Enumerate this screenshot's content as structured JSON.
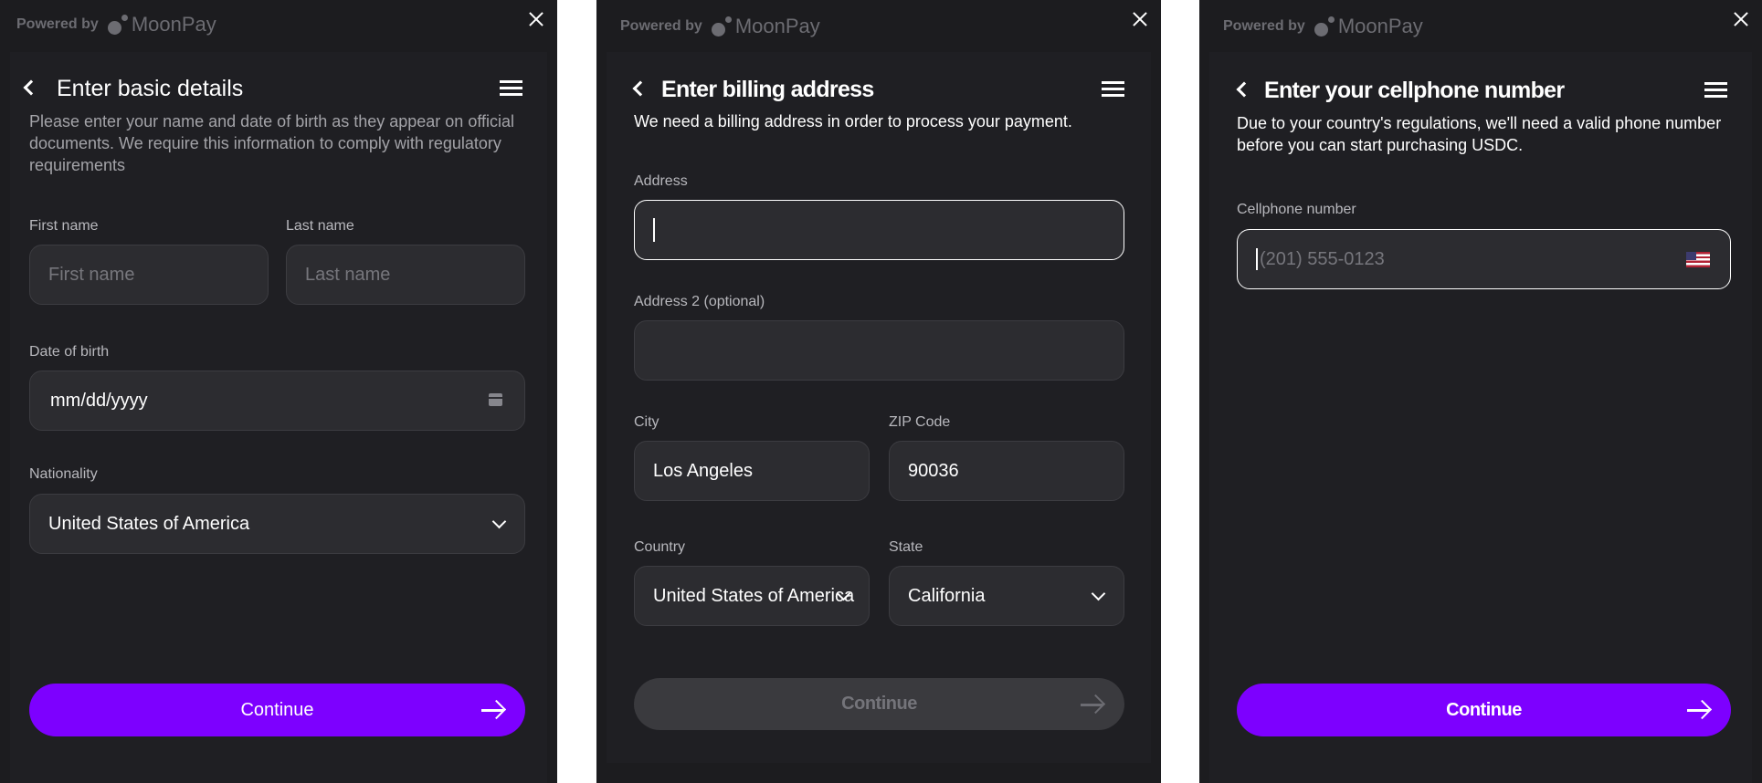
{
  "brand": {
    "powered_by": "Powered by",
    "name": "MoonPay"
  },
  "colors": {
    "accent": "#7d00ff",
    "panel_bg": "#1c1c1f",
    "field_bg": "#2c2c30"
  },
  "panel1": {
    "title": "Enter basic details",
    "description": "Please enter your name and date of birth as they appear on official documents. We require this information to comply with regulatory requirements",
    "first_name": {
      "label": "First name",
      "placeholder": "First name"
    },
    "last_name": {
      "label": "Last name",
      "placeholder": "Last name"
    },
    "dob": {
      "label": "Date of birth",
      "value": "mm/dd/yyyy"
    },
    "nationality": {
      "label": "Nationality",
      "value": "United States of America"
    },
    "continue_label": "Continue"
  },
  "panel2": {
    "title": "Enter billing address",
    "description": "We need a billing address in order to process your payment.",
    "address": {
      "label": "Address",
      "value": ""
    },
    "address2": {
      "label": "Address 2 (optional)",
      "value": ""
    },
    "city": {
      "label": "City",
      "value": "Los Angeles"
    },
    "zip": {
      "label": "ZIP Code",
      "value": "90036"
    },
    "country": {
      "label": "Country",
      "value": "United States of America"
    },
    "state": {
      "label": "State",
      "value": "California"
    },
    "continue_label": "Continue"
  },
  "panel3": {
    "title": "Enter your cellphone number",
    "description": "Due to your country's regulations, we'll need a valid phone number before you can start purchasing USDC.",
    "phone": {
      "label": "Cellphone number",
      "placeholder": "(201) 555-0123"
    },
    "country_flag": "us-flag-icon",
    "continue_label": "Continue"
  }
}
